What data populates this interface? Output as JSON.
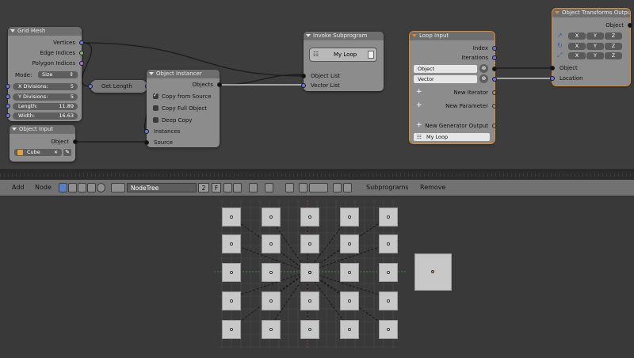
{
  "grid_mesh": {
    "title": "Grid Mesh",
    "outputs": [
      "Vertices",
      "Edge Indices",
      "Polygon Indices"
    ],
    "mode_label": "Mode:",
    "mode_value": "Size",
    "x_div_label": "X Divisions:",
    "x_div_value": "5",
    "y_div_label": "Y Divisions:",
    "y_div_value": "5",
    "length_label": "Length:",
    "length_value": "11.89",
    "width_label": "Width:",
    "width_value": "16.63"
  },
  "get_length": {
    "label": "Get Length"
  },
  "object_instancer": {
    "title": "Object Instancer",
    "output": "Objects",
    "copy_from_source": "Copy from Source",
    "copy_full_object": "Copy Full Object",
    "deep_copy": "Deep Copy",
    "instances": "Instances",
    "source": "Source"
  },
  "object_input": {
    "title": "Object Input",
    "output": "Object",
    "object_value": "Cube"
  },
  "invoke_subprogram": {
    "title": "Invoke Subprogram",
    "program": "My Loop",
    "object_list": "Object List",
    "vector_list": "Vector List"
  },
  "loop_input": {
    "title": "Loop Input",
    "index": "Index",
    "iterations": "Iterations",
    "param_object": "Object",
    "param_vector": "Vector",
    "new_iterator": "New Iterator",
    "new_parameter": "New Parameter",
    "new_generator_output": "New Generator Output",
    "loop_name": "My Loop"
  },
  "transforms_output": {
    "title": "Object Transforms Output",
    "output": "Object",
    "axes": [
      "X",
      "Y",
      "Z"
    ],
    "in_object": "Object",
    "in_location": "Location"
  },
  "toolbar": {
    "add": "Add",
    "node": "Node",
    "tree_name": "NodeTree",
    "users": "2",
    "fake": "F",
    "subprograms": "Subprograms",
    "remove": "Remove"
  },
  "colors": {
    "selected_outline": "#e08a2a",
    "socket_vector": "#6b75e0",
    "socket_object": "#111111",
    "toolbar": "#727272"
  }
}
